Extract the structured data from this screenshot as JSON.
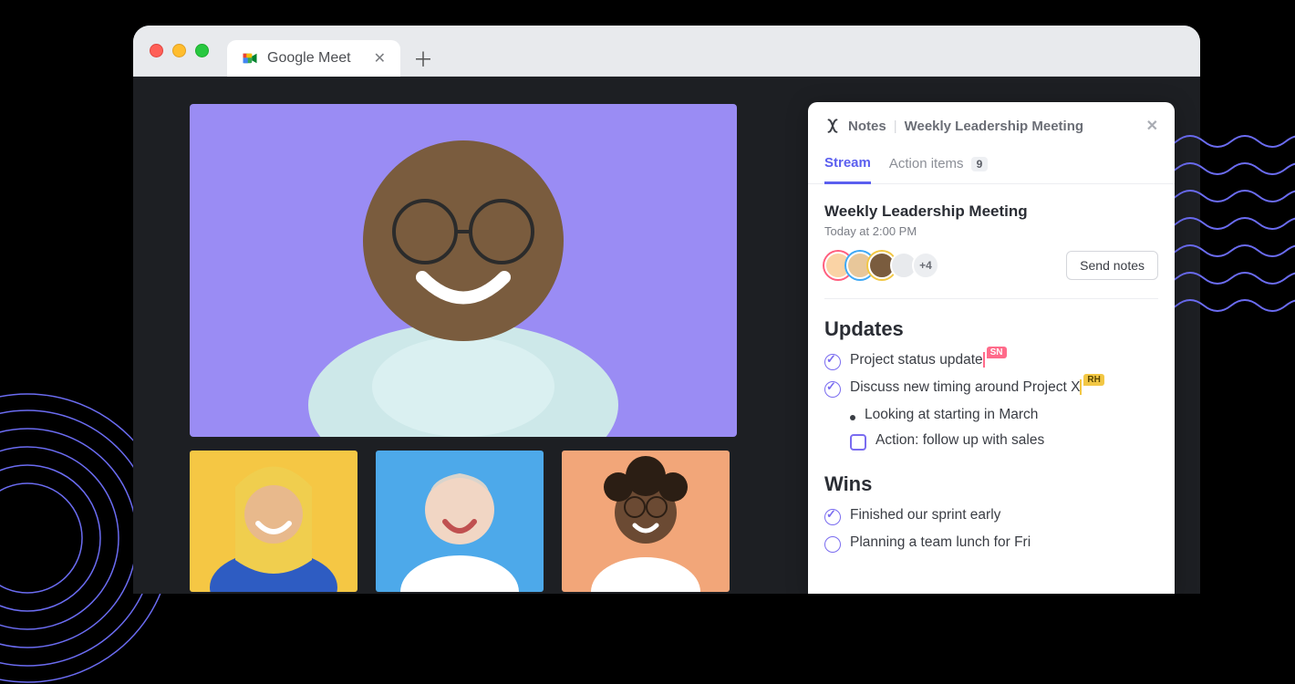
{
  "tab": {
    "title": "Google Meet"
  },
  "panel": {
    "label_notes": "Notes",
    "label_meeting": "Weekly Leadership Meeting",
    "tabs": {
      "stream": "Stream",
      "action_items": "Action items",
      "action_count": "9"
    },
    "meeting": {
      "title": "Weekly Leadership Meeting",
      "time": "Today at 2:00 PM",
      "extra_count": "+4",
      "send_label": "Send notes"
    },
    "sections": {
      "updates": {
        "heading": "Updates",
        "items": {
          "status": "Project status update",
          "status_tag": "SN",
          "timing": "Discuss new timing around Project X",
          "timing_tag": "RH",
          "march": "Looking at starting in March",
          "action": "Action: follow up with sales"
        }
      },
      "wins": {
        "heading": "Wins",
        "items": {
          "sprint": "Finished our sprint early",
          "lunch": "Planning a team lunch for Fri"
        }
      }
    }
  }
}
